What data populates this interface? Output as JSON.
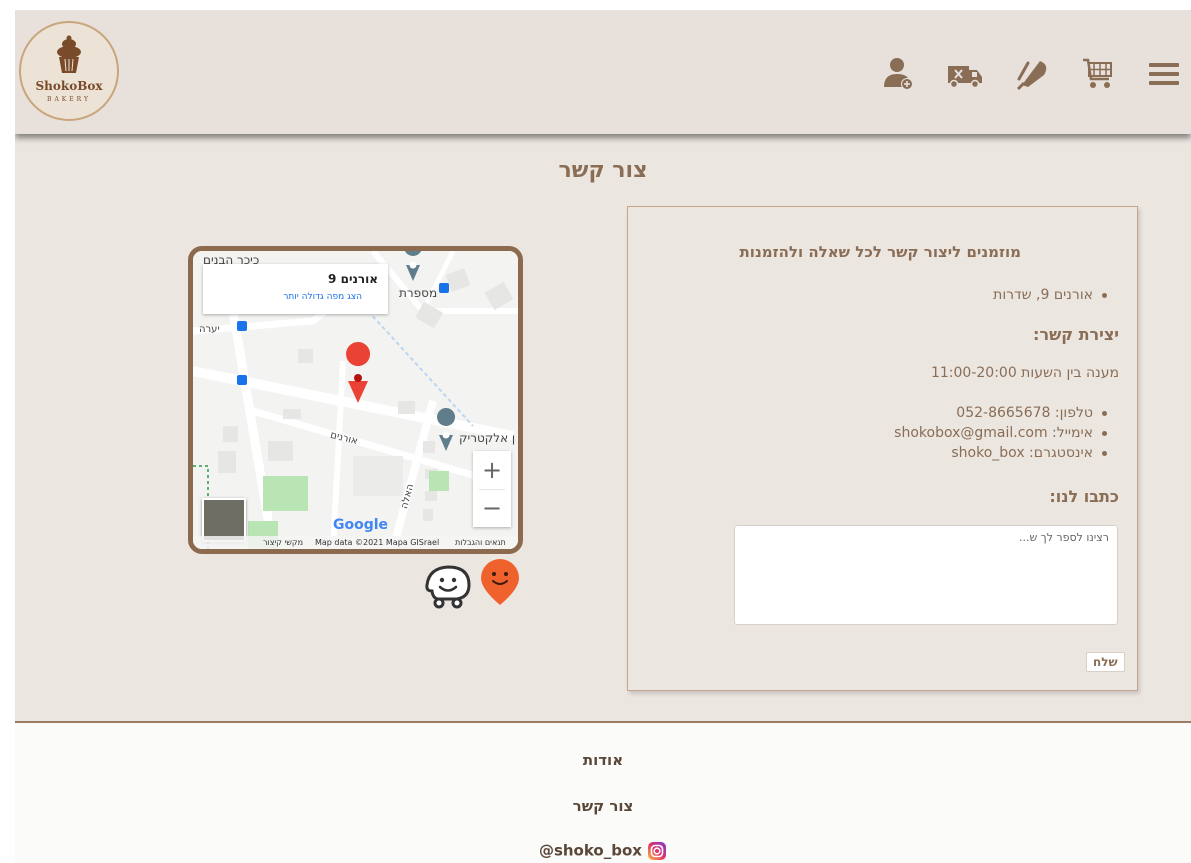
{
  "header": {
    "logo_brand": "ShokoBox",
    "logo_sub": "BAKERY",
    "icons": [
      "user-add-icon",
      "delivery-truck-icon",
      "whisk-icon",
      "shopping-cart-icon",
      "menu-icon"
    ]
  },
  "page_title": "צור קשר",
  "contact": {
    "headline": "מוזמנים ליצור קשר לכל שאלה ולהזמנות",
    "address": "אורנים 9, שדרות",
    "section_contact": "יצירת קשר:",
    "hours": "מענה בין השעות 11:00-20:00",
    "details": [
      "טלפון: 052-8665678",
      "אימייל: shokobox@gmail.com",
      "אינסטגרם: shoko_box"
    ],
    "section_write": "כתבו לנו:",
    "message_placeholder": "רצינו לספר לך ש...",
    "send_label": "שלח"
  },
  "map": {
    "place_name": "אורנים 9",
    "larger_map_link": "הצג מפה גדולה יותר",
    "labels": {
      "top_left": "כיכר הבנים",
      "barbershop": "מספרת",
      "electric": "ן אלקטריק",
      "street_ornim": "אורנים",
      "street_haalla": "האלה",
      "street_yaara": "יערה"
    },
    "zoom_in": "+",
    "zoom_out": "−",
    "google": "Google",
    "attribution": {
      "terms": "תנאים והגבלות",
      "data": "Map data ©2021 Mapa GISrael",
      "shortcuts": "מקשי קיצור"
    }
  },
  "footer": {
    "about": "אודות",
    "contact": "צור קשר",
    "instagram": "@shoko_box"
  },
  "colors": {
    "accent_text": "#8a6d55",
    "map_border": "#8c6a4d",
    "page_bg": "#ece6e1",
    "waze_orange": "#f0622d"
  }
}
